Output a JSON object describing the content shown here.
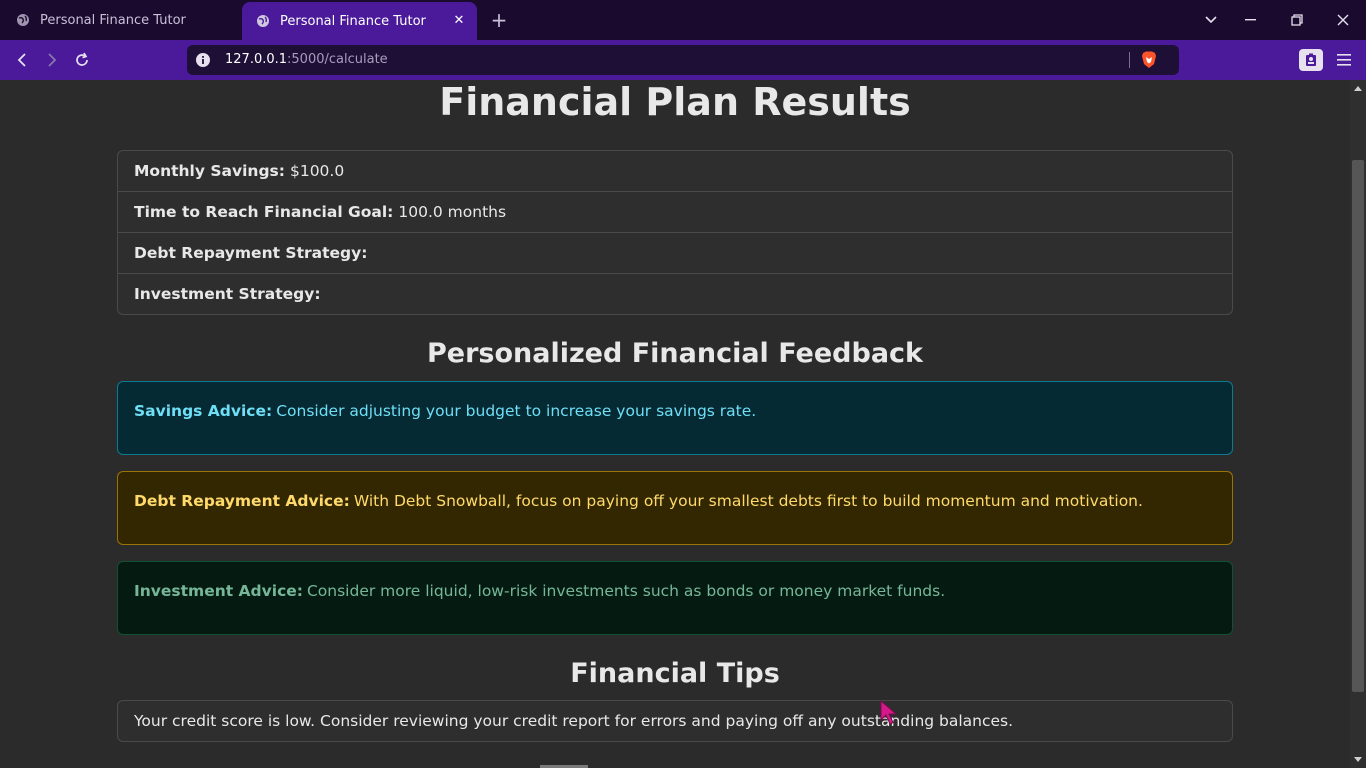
{
  "browser": {
    "tabs": [
      {
        "title": "Personal Finance Tutor",
        "active": false
      },
      {
        "title": "Personal Finance Tutor",
        "active": true
      }
    ],
    "url_host": "127.0.0.1",
    "url_path": ":5000/calculate",
    "colors": {
      "tab_strip": "#1a0b2e",
      "toolbar": "#4b1a9a",
      "omnibox": "#1e0f36"
    }
  },
  "page": {
    "title": "Financial Plan Results",
    "results": [
      {
        "label": "Monthly Savings:",
        "value": "$100.0"
      },
      {
        "label": "Time to Reach Financial Goal:",
        "value": "100.0 months"
      },
      {
        "label": "Debt Repayment Strategy:",
        "value": ""
      },
      {
        "label": "Investment Strategy:",
        "value": ""
      }
    ],
    "feedback_heading": "Personalized Financial Feedback",
    "feedback": {
      "savings": {
        "label": "Savings Advice:",
        "text": "Consider adjusting your budget to increase your savings rate."
      },
      "debt": {
        "label": "Debt Repayment Advice:",
        "text": "With Debt Snowball, focus on paying off your smallest debts first to build momentum and motivation."
      },
      "investment": {
        "label": "Investment Advice:",
        "text": "Consider more liquid, low-risk investments such as bonds or money market funds."
      }
    },
    "tips_heading": "Financial Tips",
    "tips": [
      "Your credit score is low. Consider reviewing your credit report for errors and paying off any outstanding balances."
    ]
  }
}
